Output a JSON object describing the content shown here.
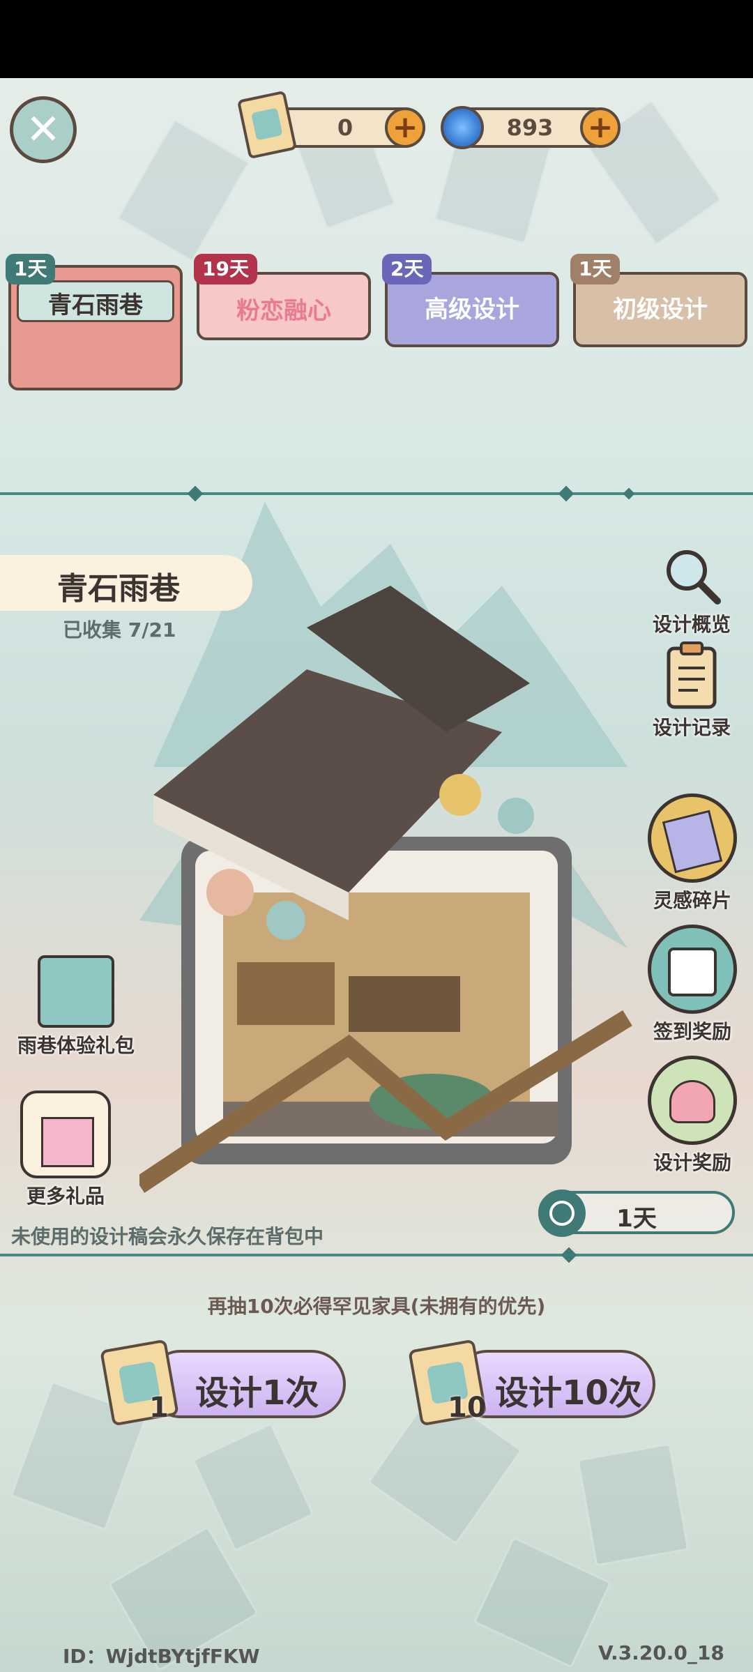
{
  "currency": {
    "scrolls": "0",
    "gems": "893"
  },
  "tabs": [
    {
      "badge": "1天",
      "label": "青石雨巷"
    },
    {
      "badge": "19天",
      "label": "粉恋融心"
    },
    {
      "badge": "2天",
      "label": "高级设计"
    },
    {
      "badge": "1天",
      "label": "初级设计"
    }
  ],
  "collection": {
    "title": "青石雨巷",
    "count": "已收集 7/21"
  },
  "right_menu": {
    "overview": "设计概览",
    "records": "设计记录",
    "fragments": "灵感碎片",
    "checkin": "签到奖励",
    "design_reward": "设计奖励"
  },
  "left_menu": {
    "pack": "雨巷体验礼包",
    "more_gifts": "更多礼品"
  },
  "timer": "1天",
  "notice": "未使用的设计稿会永久保存在背包中",
  "hint": "再抽10次必得罕见家具(未拥有的优先)",
  "draw": {
    "once_label": "设计1次",
    "once_count": "1",
    "ten_label": "设计10次",
    "ten_count": "10"
  },
  "footer": {
    "id": "ID：WjdtBYtjfFKW",
    "version": "V.3.20.0_18"
  },
  "colors": {
    "tab1": "#e89a90",
    "tab2": "#f6c9c8",
    "tab3": "#a9a6de",
    "tab4": "#d8bfa8",
    "accent": "#3f7a77"
  }
}
